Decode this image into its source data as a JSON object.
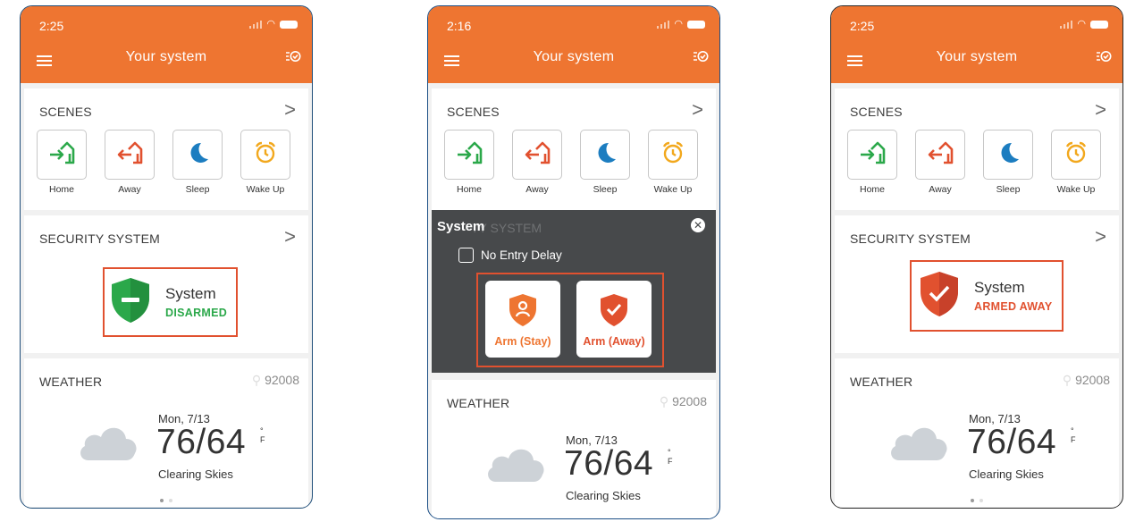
{
  "phones": [
    {
      "status_time": "2:25",
      "app_title": "Your system",
      "scenes": {
        "title": "SCENES",
        "items": [
          {
            "label": "Home",
            "icon": "home-arrive-icon",
            "color": "#2ba84a"
          },
          {
            "label": "Away",
            "icon": "home-leave-icon",
            "color": "#e1512f"
          },
          {
            "label": "Sleep",
            "icon": "moon-icon",
            "color": "#1c7dc0"
          },
          {
            "label": "Wake Up",
            "icon": "alarm-clock-icon",
            "color": "#f2a81d"
          }
        ]
      },
      "security": {
        "title": "SECURITY SYSTEM",
        "system_name": "System",
        "state": "DISARMED",
        "state_color": "#2ba84a",
        "shield_icon": "shield-disarmed-icon"
      },
      "weather": {
        "title": "WEATHER",
        "zip": "92008",
        "date": "Mon, 7/13",
        "temps": "76/64",
        "degree_symbol": "°",
        "unit": "F",
        "description": "Clearing Skies"
      }
    },
    {
      "status_time": "2:16",
      "app_title": "Your system",
      "scenes": {
        "title": "SCENES",
        "items": [
          {
            "label": "Home"
          },
          {
            "label": "Away"
          },
          {
            "label": "Sleep"
          },
          {
            "label": "Wake Up"
          }
        ]
      },
      "overlay": {
        "title": "System",
        "ghost_text": "TY SYSTEM",
        "checkbox_label": "No Entry Delay",
        "checkbox_checked": false,
        "arm_stay_label": "Arm (Stay)",
        "arm_stay_color": "#ee7531",
        "arm_away_label": "Arm (Away)",
        "arm_away_color": "#e1512f"
      },
      "weather": {
        "title": "WEATHER",
        "zip": "92008",
        "date": "Mon, 7/13",
        "temps": "76/64",
        "degree_symbol": "°",
        "unit": "F",
        "description": "Clearing Skies"
      }
    },
    {
      "status_time": "2:25",
      "app_title": "Your system",
      "scenes": {
        "title": "SCENES",
        "items": [
          {
            "label": "Home"
          },
          {
            "label": "Away"
          },
          {
            "label": "Sleep"
          },
          {
            "label": "Wake Up"
          }
        ]
      },
      "security": {
        "title": "SECURITY SYSTEM",
        "system_name": "System",
        "state": "ARMED AWAY",
        "state_color": "#e1512f",
        "shield_icon": "shield-armed-icon"
      },
      "weather": {
        "title": "WEATHER",
        "zip": "92008",
        "date": "Mon, 7/13",
        "temps": "76/64",
        "degree_symbol": "°",
        "unit": "F",
        "description": "Clearing Skies"
      }
    }
  ]
}
